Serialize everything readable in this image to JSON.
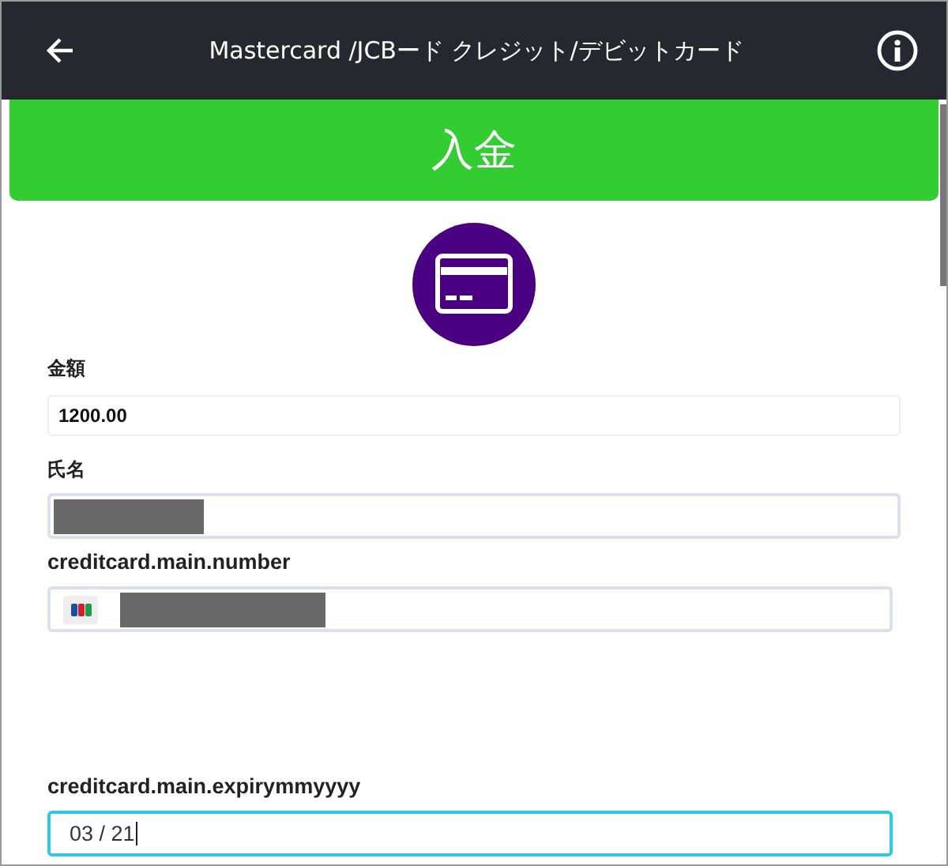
{
  "header": {
    "title": "Mastercard /JCBード クレジット/デビットカード"
  },
  "banner": {
    "title": "入金"
  },
  "fields": [
    {
      "label": "金額",
      "value": "1200.00",
      "kind": "plain",
      "redacted": false,
      "focused": false
    },
    {
      "label": "氏名",
      "kind": "text",
      "redacted": true,
      "focused": false
    },
    {
      "label": "creditcard.main.number",
      "kind": "card",
      "redacted": true,
      "focused": false
    },
    {
      "label": "creditcard.main.expirymmyyyy",
      "value": "03 / 21",
      "kind": "text",
      "redacted": false,
      "focused": true
    }
  ]
}
